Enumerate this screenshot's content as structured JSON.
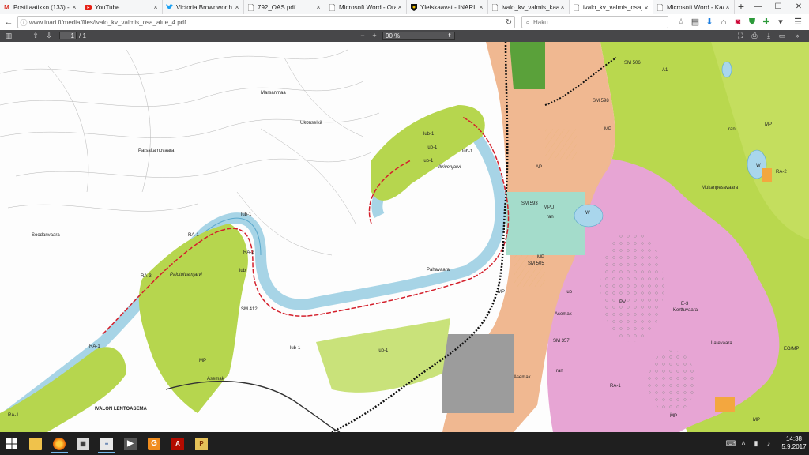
{
  "tabs": [
    {
      "title": "Postilaatikko (133) - isos",
      "icon": "gmail-icon",
      "active": false
    },
    {
      "title": "YouTube",
      "icon": "youtube-icon",
      "active": false
    },
    {
      "title": "Victoria Brownworth (@",
      "icon": "twitter-icon",
      "active": false
    },
    {
      "title": "792_OAS.pdf",
      "icon": "pdf-icon",
      "active": false
    },
    {
      "title": "Microsoft Word - Oravi-i",
      "icon": "document-icon",
      "active": false
    },
    {
      "title": "Yleiskaavat - INARI.FI",
      "icon": "inari-shield-icon",
      "active": false
    },
    {
      "title": "ivalo_kv_valmis_kaavam",
      "icon": "document-icon",
      "active": false
    },
    {
      "title": "ivalo_kv_valmis_osa_alue",
      "icon": "document-icon",
      "active": true
    },
    {
      "title": "Microsoft Word - Kaava",
      "icon": "document-icon",
      "active": false
    }
  ],
  "new_tab_label": "+",
  "window_controls": {
    "minimize": "—",
    "maximize": "☐",
    "close": "✕"
  },
  "nav": {
    "back": "←",
    "url": "www.inari.fi/media/files/ivalo_kv_valmis_osa_alue_4.pdf",
    "reload": "↻",
    "search_placeholder": "Haku",
    "toolbar_icons": [
      "star-icon",
      "reading-list-icon",
      "download-icon",
      "home-icon",
      "pocket-icon",
      "shield-icon",
      "extension-icon",
      "menu-icon"
    ]
  },
  "pdf": {
    "page_current": "1",
    "page_count": "/ 1",
    "zoom_out": "−",
    "zoom_in": "+",
    "zoom": "90 %",
    "zoom_arrow": "⬍"
  },
  "map_labels": {
    "soodanvaara": "Soodanvaara",
    "marsanmaa": "Marsanmaa",
    "parsaltamovaara": "Parsaltamovaara",
    "ukonselkä": "Ukonselkä",
    "ilirivenjarvi": "Ilirivenjarvi",
    "pahavaara": "Pahavaara",
    "palotuivamjarvi": "Palotuivamjarvi",
    "kettuvaara": "Kerttuvaara",
    "mukanpesavaara": "Mukanpesavaara",
    "latevaara": "Latevaara",
    "ivalon_lentoasema": "IVALON LENTOASEMA",
    "lub1_a": "lub-1",
    "lub1_b": "lub-1",
    "lub1_c": "lub-1",
    "lub1_d": "lub-1",
    "lub1_e": "lub-1",
    "lub1_f": "lub-1",
    "lub1_g": "lub-1",
    "lub": "lub",
    "lub2": "lub",
    "mp1": "MP",
    "mp2": "MP",
    "mp3": "MP",
    "mp4": "MP",
    "mp5": "MP",
    "mp6": "MP",
    "mp7": "MP",
    "mpu": "MPU",
    "w1": "W",
    "w2": "W",
    "ran1": "ran",
    "ran2": "ran",
    "ran3": "ran",
    "asemak1": "Asemak",
    "asemak2": "Asemak",
    "asemak3": "Asemak",
    "pv": "PV",
    "e3": "E-3",
    "eomp": "EO/MP",
    "a1": "A1",
    "ap": "AP",
    "ra1": "RA-1",
    "ra2": "RA-2",
    "ra3": "RA-1",
    "ra4": "RA-2",
    "ra5": "RA-1",
    "ra6": "RA-3",
    "ra7": "RA-1",
    "sm1": "SM 593",
    "sm2": "SM 505",
    "sm3": "SM 412",
    "sm4": "SM 357",
    "sm5": "SM 598",
    "sm6": "SM 506"
  },
  "taskbar": {
    "apps": [
      "windows-start-icon",
      "file-explorer-icon",
      "firefox-icon",
      "calculator-icon",
      "word-document-icon",
      "media-player-icon",
      "app-g-icon",
      "acrobat-icon",
      "pdf-viewer-icon"
    ],
    "tray_icons": [
      "keyboard-icon",
      "chevron-up-icon",
      "network-icon",
      "volume-icon",
      "notifications-icon"
    ],
    "time": "14:38",
    "date": "5.9.2017"
  }
}
